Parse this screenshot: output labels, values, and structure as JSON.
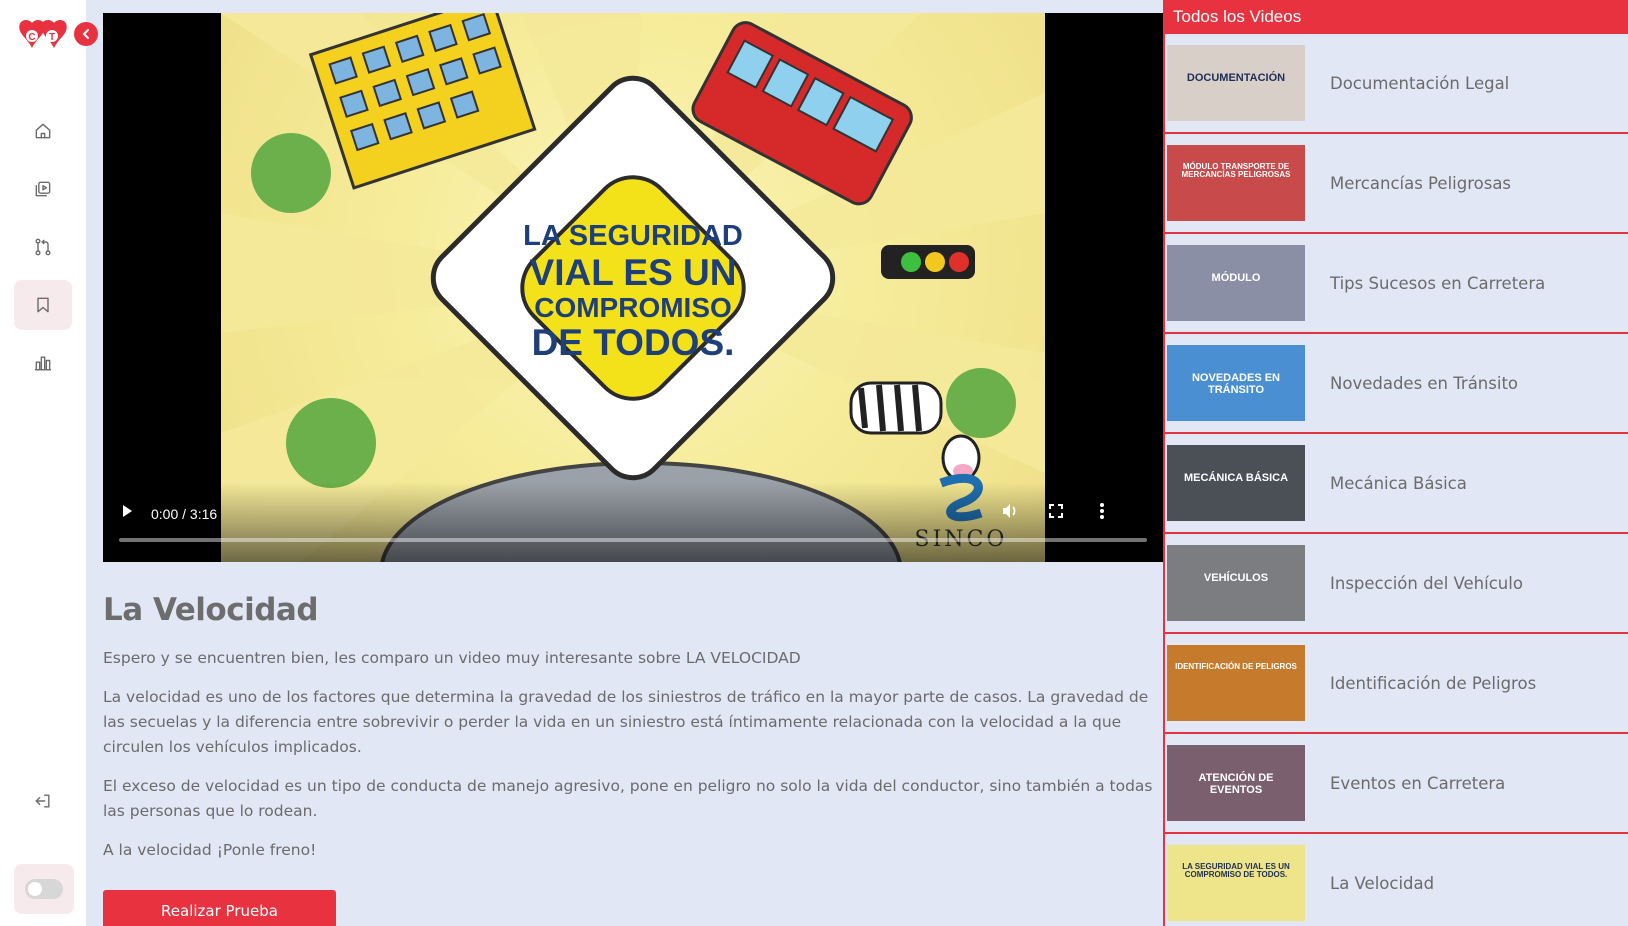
{
  "sidebar": {
    "logo_text": "CT",
    "collapse_icon": "chevron-left-icon",
    "nav": [
      {
        "icon": "home-icon"
      },
      {
        "icon": "video-library-icon"
      },
      {
        "icon": "git-pull-request-icon"
      },
      {
        "icon": "bookmark-icon",
        "active": true
      },
      {
        "icon": "bar-chart-icon"
      }
    ],
    "logout_icon": "logout-icon"
  },
  "video": {
    "time": "0:00 / 3:16",
    "progress": 0,
    "poster_text": [
      "LA SEGURIDAD",
      "VIAL ES UN",
      "COMPROMISO",
      "DE TODOS."
    ],
    "poster_logo": "SINCO"
  },
  "article": {
    "title": "La Velocidad",
    "paragraphs": [
      "Espero y se encuentren bien, les comparo un video muy interesante sobre LA VELOCIDAD",
      "La velocidad es uno de los factores que determina la gravedad de los siniestros de tráfico en la mayor parte de casos. La gravedad de las secuelas y la diferencia entre sobrevivir o perder la vida en un siniestro está íntimamente relacionada con la velocidad a la que circulen los vehículos implicados.",
      "El exceso de velocidad es un tipo de conducta de manejo agresivo, pone en peligro no solo la vida del conductor, sino también a todas las personas que lo rodean.",
      "A la velocidad ¡Ponle freno!"
    ],
    "cta_label": "Realizar Prueba"
  },
  "panel": {
    "header": "Todos los Videos",
    "items": [
      {
        "label": "Documentación Legal",
        "thumb_text": "DOCUMENTACIÓN",
        "thumb_bg": "#d9cfc9"
      },
      {
        "label": "Mercancías Peligrosas",
        "thumb_text": "MÓDULO TRANSPORTE DE MERCANCÍAS PELIGROSAS",
        "thumb_bg": "#c94a4a"
      },
      {
        "label": "Tips Sucesos en Carretera",
        "thumb_text": "MÓDULO",
        "thumb_bg": "#8a8fa6"
      },
      {
        "label": "Novedades en Tránsito",
        "thumb_text": "NOVEDADES EN TRÁNSITO",
        "thumb_bg": "#4a8fd1"
      },
      {
        "label": "Mecánica Básica",
        "thumb_text": "MECÁNICA BÁSICA",
        "thumb_bg": "#4b4f56"
      },
      {
        "label": "Inspección del Vehículo",
        "thumb_text": "VEHÍCULOS",
        "thumb_bg": "#7b7d80"
      },
      {
        "label": "Identificación de Peligros",
        "thumb_text": "IDENTIFICACIÓN DE PELIGROS",
        "thumb_bg": "#c67a2b"
      },
      {
        "label": "Eventos en Carretera",
        "thumb_text": "ATENCIÓN DE EVENTOS",
        "thumb_bg": "#7a5f6e"
      },
      {
        "label": "La Velocidad",
        "thumb_text": "LA SEGURIDAD VIAL ES UN COMPROMISO DE TODOS.",
        "thumb_bg": "#eee48a"
      }
    ]
  },
  "colors": {
    "accent": "#e8323f",
    "background": "#e2e7f5",
    "text": "#6b6b6b"
  }
}
